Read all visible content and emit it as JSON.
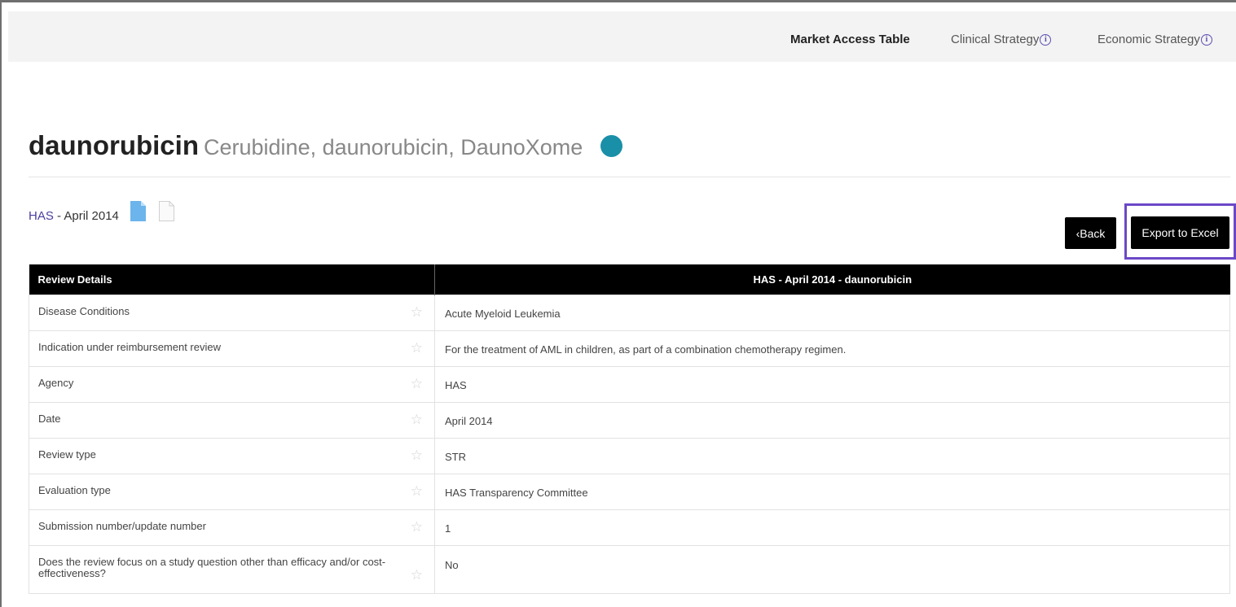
{
  "nav": {
    "market_access": "Market Access Table",
    "clinical": "Clinical Strategy",
    "economic": "Economic Strategy",
    "info_glyph": "i"
  },
  "drug": {
    "name": "daunorubicin",
    "aliases": "Cerubidine, daunorubicin, DaunoXome",
    "status_color": "#1a8fa8"
  },
  "breadcrumb": {
    "agency_link": "HAS",
    "date_suffix": " - April 2014"
  },
  "buttons": {
    "back": "‹Back",
    "export": "Export to Excel"
  },
  "table": {
    "header_left": "Review Details",
    "header_right": "HAS - April 2014 - daunorubicin",
    "star_glyph": "☆",
    "rows": [
      {
        "label": "Disease Conditions",
        "value": "Acute Myeloid Leukemia"
      },
      {
        "label": "Indication under reimbursement review",
        "value": "For the treatment of AML in children, as part of a combination chemotherapy regimen."
      },
      {
        "label": "Agency",
        "value": "HAS"
      },
      {
        "label": "Date",
        "value": "April 2014"
      },
      {
        "label": "Review type",
        "value": "STR"
      },
      {
        "label": "Evaluation type",
        "value": "HAS Transparency Committee"
      },
      {
        "label": "Submission number/update number",
        "value": "1"
      },
      {
        "label": "Does the review focus on a study question other than efficacy and/or cost-effectiveness?",
        "value": "No"
      }
    ]
  },
  "colors": {
    "accent_purple": "#6b48c7",
    "link": "#4a3ea0",
    "header_bg": "#000000"
  }
}
